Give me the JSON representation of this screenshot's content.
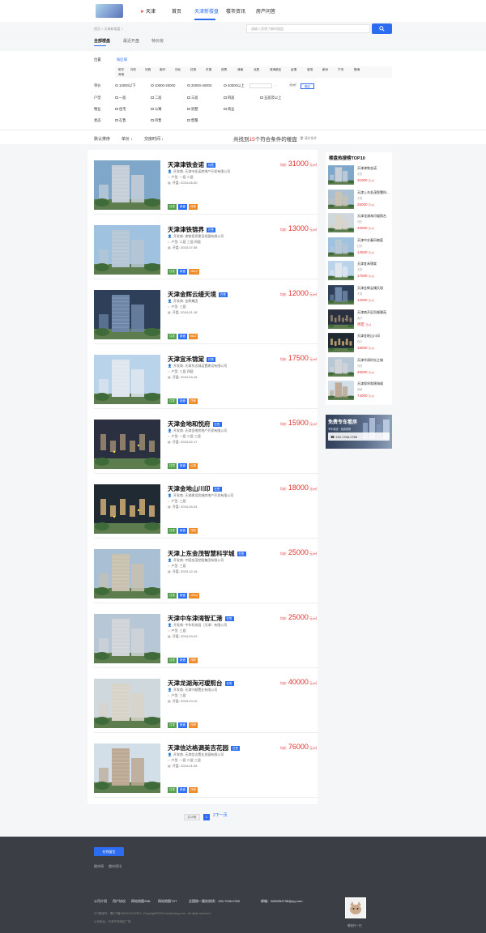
{
  "header": {
    "city": "天津",
    "nav": [
      "首页",
      "天津新楼盘",
      "楼市资讯",
      "房产问答"
    ]
  },
  "subbar": {
    "breadcrumb": "首页 > 天津新楼盘 >",
    "tabs": [
      "全部楼盘",
      "最近开盘",
      "特价房"
    ],
    "search_placeholder": "请输入您想了解的楼盘"
  },
  "filters": {
    "location_label": "位置",
    "location_value": "按区域",
    "districts": [
      "和平",
      "河东",
      "河西",
      "南开",
      "河北",
      "红桥",
      "东丽",
      "西青",
      "津南",
      "北辰",
      "滨海新区",
      "武清",
      "宝坻",
      "蓟州",
      "宁河",
      "静海",
      "其他"
    ],
    "price_label": "单价",
    "prices": [
      "10000以下",
      "10000-20000",
      "20000-40000",
      "40000以上"
    ],
    "price_sep": "-",
    "price_unit": "元/㎡",
    "price_btn": "确定",
    "room_label": "户型",
    "rooms": [
      "一居",
      "二居",
      "三居",
      "四居",
      "五居及以上"
    ],
    "type_label": "物业",
    "types": [
      "住宅",
      "公寓",
      "别墅",
      "商业"
    ],
    "status_label": "状态",
    "statuses": [
      "在售",
      "待售",
      "售罄"
    ]
  },
  "sortbar": {
    "items": [
      "默认排序",
      "单价 ↓",
      "交房时间 ↓"
    ],
    "found_prefix": "共找到",
    "found_count": "15",
    "found_suffix": "个符合条件的楼盘",
    "clear": "清空条件"
  },
  "listing_labels": {
    "developer": "开发商:",
    "layout": "户型:",
    "opening": "开盘:",
    "price_label": "均价",
    "unit": "元/㎡"
  },
  "listings": [
    {
      "name": "天津津铁金诺",
      "badge": "待售",
      "developer": "天津市金诺房地产开发有限公司",
      "layout": "一居  二居",
      "opening": "2024-06-30",
      "price": "31000",
      "tags": [
        "住宅",
        "新盘",
        "待售"
      ]
    },
    {
      "name": "天津津铁锦界",
      "badge": "在售",
      "developer": "津铁投资建设发展有限公司",
      "layout": "二居  三居  四居",
      "opening": "2023-07-08",
      "price": "13000",
      "tags": [
        "住宅",
        "新盘",
        "180㎡"
      ]
    },
    {
      "name": "天津金辉云缦天境",
      "badge": "在售",
      "developer": "金辉集团",
      "layout": "三居",
      "opening": "2024-01-18",
      "price": "12000",
      "tags": [
        "住宅",
        "新盘",
        "88㎡"
      ]
    },
    {
      "name": "天津宜禾锦棠",
      "badge": "在售",
      "developer": "天津东志城运置建设有限公司",
      "layout": "三居  四居",
      "opening": "2024-03-16",
      "price": "17500",
      "tags": [
        "住宅",
        "新盘",
        "洋房"
      ]
    },
    {
      "name": "天津金地和悦府",
      "badge": "在售",
      "developer": "天津金地房地产开发有限公司",
      "layout": "一居  二居  三居",
      "opening": "2023-02-17",
      "price": "15900",
      "tags": [
        "住宅",
        "新盘",
        "公寓"
      ]
    },
    {
      "name": "天津金地山川印",
      "badge": "在售",
      "developer": "天津建设凯城房地产开发有限公司",
      "layout": "三居",
      "opening": "2024-04-04",
      "price": "18000",
      "tags": [
        "住宅",
        "新盘",
        "洋房"
      ]
    },
    {
      "name": "天津上东金茂智慧科学城",
      "badge": "在售",
      "developer": "中国金茂控股集团有限公司",
      "layout": "三居",
      "opening": "2023-12-16",
      "price": "25000",
      "tags": [
        "住宅",
        "新盘",
        "100㎡"
      ]
    },
    {
      "name": "天津中车津湾智汇港",
      "badge": "在售",
      "developer": "中车科技园（天津）有限公司",
      "layout": "三居",
      "opening": "2024-03-03",
      "price": "25000",
      "tags": [
        "住宅",
        "新盘",
        "洋房"
      ]
    },
    {
      "name": "天津龙湖海河瑷熙台",
      "badge": "在售",
      "developer": "天津兴顺置业有限公司",
      "layout": "三居",
      "opening": "2023-10-10",
      "price": "40000",
      "tags": [
        "住宅",
        "新盘",
        "洋房"
      ]
    },
    {
      "name": "天津信达格调美吉花园",
      "badge": "在售",
      "developer": "天津信达置业发展有限公司",
      "layout": "一居  二居  三居",
      "opening": "2024-01-28",
      "price": "76000",
      "tags": [
        "住宅",
        "新盘",
        "洋房"
      ]
    }
  ],
  "top10": {
    "title": "楼盘热搜榜TOP10",
    "unit": "元/㎡",
    "items": [
      {
        "name": "天津津铁金诺",
        "area": "北辰",
        "price": "31000"
      },
      {
        "name": "天津上东金茂智慧科...",
        "area": "东丽",
        "price": "25000"
      },
      {
        "name": "天津龙湖海河瑷熙台",
        "area": "河东",
        "price": "40000"
      },
      {
        "name": "天津中交春风晓庭",
        "area": "红桥",
        "price": "14500"
      },
      {
        "name": "天津宜禾锦棠",
        "area": "北辰",
        "price": "17500"
      },
      {
        "name": "天津金辉云缦天境",
        "area": "东丽",
        "price": "12000"
      },
      {
        "name": "天津南开区恒顺雅苑",
        "area": "南开",
        "price": "待定"
      },
      {
        "name": "天津金地山川印",
        "area": "西青",
        "price": "18000"
      },
      {
        "name": "天津华润时光之城",
        "area": "河西",
        "price": "45000"
      },
      {
        "name": "天津保利和锦海阁",
        "area": "津南",
        "price": "74000"
      }
    ]
  },
  "promo": {
    "title": "免费专车看房",
    "subtitle": "专车接送 · 免费看房",
    "phone": "130-7206-0780"
  },
  "pagination": {
    "total": "共15条",
    "current": "1",
    "next": "2下一页"
  },
  "footer": {
    "button": "在线留言",
    "links": [
      "楼市网",
      "楼市资讯"
    ],
    "nav": [
      "公司介绍",
      "用户协议",
      "网站地图XML",
      "网站地图TXT"
    ],
    "hotline": "全国统一服务热线：130-7206-0780",
    "email": "邮箱：2863354738@qq.com",
    "copyright": "ICP备案号：蜀ICP备2024XXXXX号-1 | Copyright©2024 loushiwang.com . All rights reserved.",
    "copyright2": "公司地址：天津市河西区广场",
    "qr_label": "微信扫一扫"
  },
  "colors": {
    "accent": "#2b6cf0",
    "price": "#e03131",
    "tag_green": "#52a14a",
    "tag_orange": "#f08a24",
    "footer_bg": "#3b3f45"
  }
}
